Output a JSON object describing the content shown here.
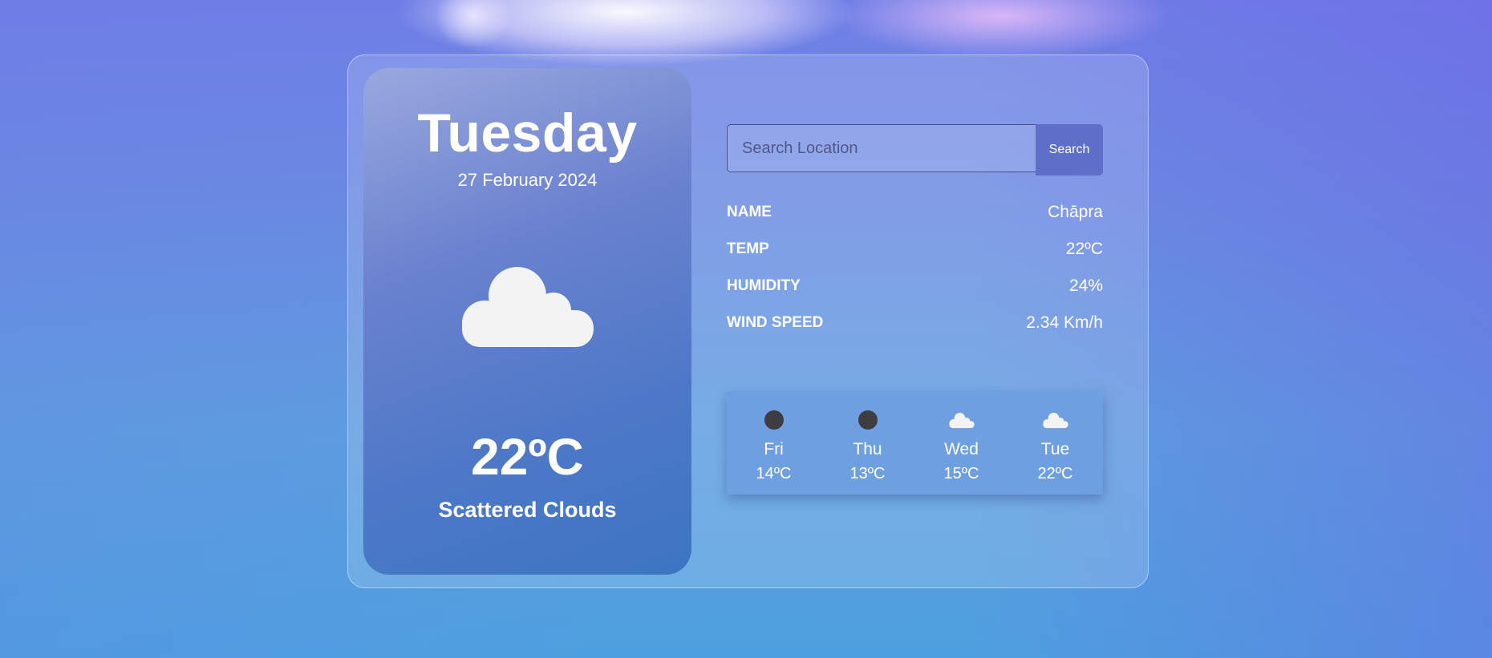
{
  "today": {
    "day": "Tuesday",
    "date": "27 February 2024",
    "icon": "cloud-icon",
    "temp": "22ºC",
    "description": "Scattered Clouds"
  },
  "search": {
    "placeholder": "Search Location",
    "value": "",
    "button_label": "Search"
  },
  "details": [
    {
      "label": "NAME",
      "value": "Chāpra"
    },
    {
      "label": "TEMP",
      "value": "22ºC"
    },
    {
      "label": "HUMIDITY",
      "value": "24%"
    },
    {
      "label": "WIND SPEED",
      "value": "2.34 Km/h"
    }
  ],
  "forecast": [
    {
      "day": "Fri",
      "temp": "14ºC",
      "icon": "moon-icon"
    },
    {
      "day": "Thu",
      "temp": "13ºC",
      "icon": "moon-icon"
    },
    {
      "day": "Wed",
      "temp": "15ºC",
      "icon": "cloud-icon"
    },
    {
      "day": "Tue",
      "temp": "22ºC",
      "icon": "cloud-icon"
    }
  ],
  "colors": {
    "card_gradient_top": "#9aa8de",
    "card_gradient_bottom": "#3d75c2",
    "search_button": "#5f6fc8",
    "forecast_panel": "#6e9fe0"
  }
}
